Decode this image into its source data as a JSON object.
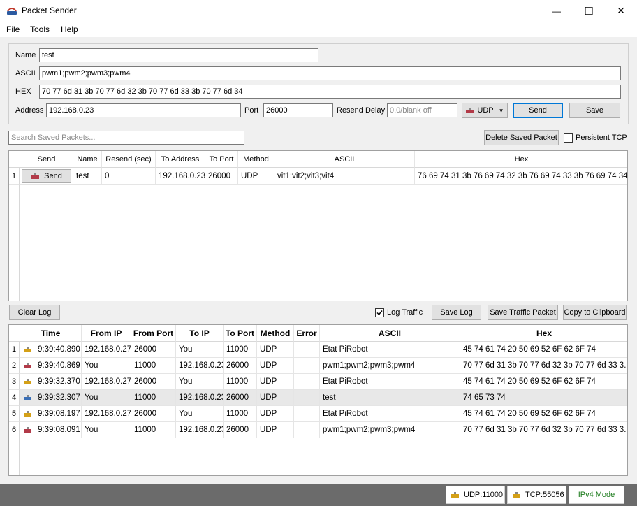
{
  "window": {
    "title": "Packet Sender",
    "minimize_glyph": "—",
    "maximize_glyph": "☐",
    "close_glyph": "✕"
  },
  "menu": [
    "File",
    "Tools",
    "Help"
  ],
  "form": {
    "name_label": "Name",
    "name_value": "test",
    "ascii_label": "ASCII",
    "ascii_value": "pwm1;pwm2;pwm3;pwm4",
    "hex_label": "HEX",
    "hex_value": "70 77 6d 31 3b 70 77 6d 32 3b 70 77 6d 33 3b 70 77 6d 34",
    "address_label": "Address",
    "address_value": "192.168.0.23",
    "port_label": "Port",
    "port_value": "26000",
    "resend_label": "Resend Delay",
    "resend_placeholder": "0.0/blank off",
    "protocol_value": "UDP",
    "send_label": "Send",
    "save_label": "Save"
  },
  "saved_toolbar": {
    "search_placeholder": "Search Saved Packets...",
    "delete_label": "Delete Saved Packet",
    "persistent_tcp_label": "Persistent TCP"
  },
  "saved_table": {
    "headers": [
      "Send",
      "Name",
      "Resend (sec)",
      "To Address",
      "To Port",
      "Method",
      "ASCII",
      "Hex"
    ],
    "rows": [
      {
        "num": "1",
        "send": "Send",
        "name": "test",
        "resend": "0",
        "address": "192.168.0.23",
        "port": "26000",
        "method": "UDP",
        "ascii": "vit1;vit2;vit3;vit4",
        "hex": "76 69 74 31 3b 76 69 74 32 3b 76 69 74 33 3b 76 69 74 34"
      }
    ]
  },
  "log_toolbar": {
    "clear_label": "Clear Log",
    "log_traffic_label": "Log Traffic",
    "save_log_label": "Save Log",
    "save_traffic_label": "Save Traffic Packet",
    "copy_label": "Copy to Clipboard"
  },
  "log_table": {
    "headers": [
      "Time",
      "From IP",
      "From Port",
      "To IP",
      "To Port",
      "Method",
      "Error",
      "ASCII",
      "Hex"
    ],
    "rows": [
      {
        "num": "1",
        "dir": "in",
        "time": "9:39:40.890",
        "from_ip": "192.168.0.27",
        "from_port": "26000",
        "to_ip": "You",
        "to_port": "11000",
        "method": "UDP",
        "error": "",
        "ascii": "Etat PiRobot",
        "hex": "45 74 61 74 20 50 69 52 6F 62 6F 74"
      },
      {
        "num": "2",
        "dir": "out",
        "time": "9:39:40.869",
        "from_ip": "You",
        "from_port": "11000",
        "to_ip": "192.168.0.23",
        "to_port": "26000",
        "method": "UDP",
        "error": "",
        "ascii": "pwm1;pwm2;pwm3;pwm4",
        "hex": "70 77 6d 31 3b 70 77 6d 32 3b 70 77 6d 33 3..."
      },
      {
        "num": "3",
        "dir": "in",
        "time": "9:39:32.370",
        "from_ip": "192.168.0.27",
        "from_port": "26000",
        "to_ip": "You",
        "to_port": "11000",
        "method": "UDP",
        "error": "",
        "ascii": "Etat PiRobot",
        "hex": "45 74 61 74 20 50 69 52 6F 62 6F 74"
      },
      {
        "num": "4",
        "dir": "sel",
        "time": "9:39:32.307",
        "from_ip": "You",
        "from_port": "11000",
        "to_ip": "192.168.0.23",
        "to_port": "26000",
        "method": "UDP",
        "error": "",
        "ascii": "test",
        "hex": "74 65 73 74"
      },
      {
        "num": "5",
        "dir": "in",
        "time": "9:39:08.197",
        "from_ip": "192.168.0.27",
        "from_port": "26000",
        "to_ip": "You",
        "to_port": "11000",
        "method": "UDP",
        "error": "",
        "ascii": "Etat PiRobot",
        "hex": "45 74 61 74 20 50 69 52 6F 62 6F 74"
      },
      {
        "num": "6",
        "dir": "out",
        "time": "9:39:08.091",
        "from_ip": "You",
        "from_port": "11000",
        "to_ip": "192.168.0.23",
        "to_port": "26000",
        "method": "UDP",
        "error": "",
        "ascii": "pwm1;pwm2;pwm3;pwm4",
        "hex": "70 77 6d 31 3b 70 77 6d 32 3b 70 77 6d 33 3..."
      }
    ]
  },
  "status": {
    "udp": "UDP:11000",
    "tcp": "TCP:55056",
    "mode": "IPv4 Mode"
  },
  "colors": {
    "incoming_icon": "#d4a017",
    "outgoing_icon": "#b23a48",
    "selected_icon": "#3b6fb6",
    "mode_text": "#1a7a1a"
  }
}
